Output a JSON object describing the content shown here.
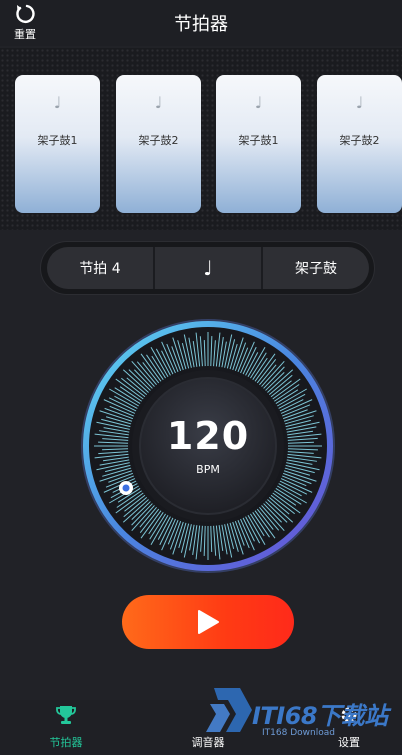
{
  "header": {
    "title": "节拍器",
    "reset_label": "重置"
  },
  "cards": [
    {
      "note": "♩",
      "label": "架子鼓1"
    },
    {
      "note": "♩",
      "label": "架子鼓2"
    },
    {
      "note": "♩",
      "label": "架子鼓1"
    },
    {
      "note": "♩",
      "label": "架子鼓2"
    }
  ],
  "segments": {
    "beat": "节拍 4",
    "note": "♩",
    "sound": "架子鼓"
  },
  "dial": {
    "bpm": "120",
    "unit": "BPM"
  },
  "bottom_nav": {
    "metronome": "节拍器",
    "tuner": "调音器",
    "settings": "设置"
  },
  "watermark": {
    "brand": "ITI68下载站",
    "sub": "IT168 Download"
  },
  "colors": {
    "accent_green": "#23c79a",
    "play_orange": "#ff4a16",
    "dial_cyan": "#5fd8f2",
    "dial_purple": "#5a5adc"
  },
  "icons": {
    "reset": "reset-icon",
    "play": "play-icon",
    "metronome_nav": "trophy-icon",
    "settings_nav": "gear-icon"
  }
}
